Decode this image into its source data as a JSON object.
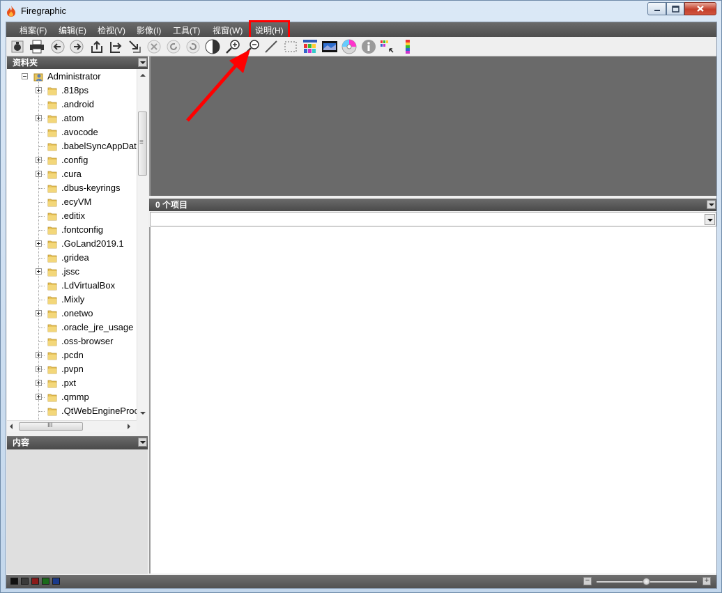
{
  "window": {
    "title": "Firegraphic",
    "accent_color": "#ff0000"
  },
  "menu": {
    "items": [
      {
        "label": "档案(F)"
      },
      {
        "label": "编辑(E)"
      },
      {
        "label": "检视(V)"
      },
      {
        "label": "影像(I)"
      },
      {
        "label": "工具(T)"
      },
      {
        "label": "视窗(W)"
      },
      {
        "label": "说明(H)"
      }
    ],
    "highlighted": "说明(H)"
  },
  "toolbar": {
    "icons": [
      "camera-icon",
      "print-icon",
      "back-icon",
      "forward-icon",
      "upload-icon",
      "export-icon",
      "move-icon",
      "delete-icon",
      "rotate-left-icon",
      "rotate-right-icon",
      "contrast-icon",
      "zoom-in-icon",
      "zoom-out-icon",
      "line-icon",
      "select-rect-icon",
      "thumbnails-icon",
      "slideshow-icon",
      "burn-disc-icon",
      "info-icon",
      "histogram-icon",
      "color-levels-icon"
    ]
  },
  "folders_pane": {
    "title": "资料夹",
    "root": "Administrator",
    "items": [
      {
        "label": ".818ps",
        "expandable": true
      },
      {
        "label": ".android",
        "expandable": false
      },
      {
        "label": ".atom",
        "expandable": true
      },
      {
        "label": ".avocode",
        "expandable": false
      },
      {
        "label": ".babelSyncAppDat",
        "expandable": false
      },
      {
        "label": ".config",
        "expandable": true
      },
      {
        "label": ".cura",
        "expandable": true
      },
      {
        "label": ".dbus-keyrings",
        "expandable": false
      },
      {
        "label": ".ecyVM",
        "expandable": false
      },
      {
        "label": ".editix",
        "expandable": false
      },
      {
        "label": ".fontconfig",
        "expandable": false
      },
      {
        "label": ".GoLand2019.1",
        "expandable": true
      },
      {
        "label": ".gridea",
        "expandable": false
      },
      {
        "label": ".jssc",
        "expandable": true
      },
      {
        "label": ".LdVirtualBox",
        "expandable": false
      },
      {
        "label": ".Mixly",
        "expandable": false
      },
      {
        "label": ".onetwo",
        "expandable": true
      },
      {
        "label": ".oracle_jre_usage",
        "expandable": false
      },
      {
        "label": ".oss-browser",
        "expandable": false
      },
      {
        "label": ".pcdn",
        "expandable": true
      },
      {
        "label": ".pvpn",
        "expandable": true
      },
      {
        "label": ".pxt",
        "expandable": true
      },
      {
        "label": ".qmmp",
        "expandable": true
      },
      {
        "label": ".QtWebEngineProc",
        "expandable": false
      }
    ],
    "hscroll_grip": "III",
    "vscroll_grip": "≡"
  },
  "content_pane": {
    "title": "内容"
  },
  "file_list": {
    "header": "0 个项目",
    "path_value": ""
  },
  "statusbar": {
    "swatches": [
      "#111111",
      "#3a3a3a",
      "#8a1a1a",
      "#1a6a1a",
      "#1a3a8a"
    ],
    "zoom_minus": "−",
    "zoom_plus": "+",
    "zoom_level": 0.5
  }
}
